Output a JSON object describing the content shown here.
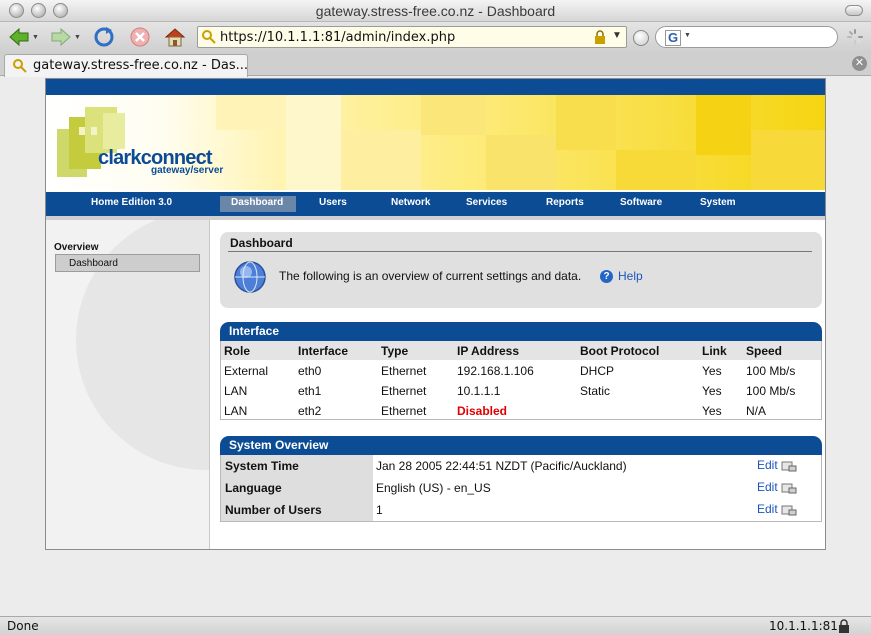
{
  "browser": {
    "window_title": "gateway.stress-free.co.nz - Dashboard",
    "url": "https://10.1.1.1:81/admin/index.php",
    "tab_title": "gateway.stress-free.co.nz - Das...",
    "status_left": "Done",
    "status_right": "10.1.1.1:81",
    "icons": [
      "back-icon",
      "forward-icon",
      "reload-icon",
      "stop-icon",
      "home-icon",
      "lock-icon",
      "google-icon",
      "spinner-icon"
    ]
  },
  "app": {
    "logo_main": "clarkconnect",
    "logo_sub": "gateway/server",
    "edition": "Home Edition 3.0",
    "nav": [
      "Dashboard",
      "Users",
      "Network",
      "Services",
      "Reports",
      "Software",
      "System"
    ],
    "active_nav": "Dashboard",
    "colors": {
      "brand_blue": "#0c4c94",
      "banner_yellow": "#f5d510",
      "error_red": "#e00000",
      "link_blue": "#1c55b8"
    }
  },
  "sidebar": {
    "heading": "Overview",
    "items": [
      "Dashboard"
    ]
  },
  "dashboard": {
    "title": "Dashboard",
    "description": "The following is an overview of current settings and data.",
    "help": "Help"
  },
  "interface": {
    "title": "Interface",
    "columns": [
      "Role",
      "Interface",
      "Type",
      "IP Address",
      "Boot Protocol",
      "Link",
      "Speed"
    ],
    "rows": [
      [
        "External",
        "eth0",
        "Ethernet",
        "192.168.1.106",
        "DHCP",
        "Yes",
        "100 Mb/s"
      ],
      [
        "LAN",
        "eth1",
        "Ethernet",
        "10.1.1.1",
        "Static",
        "Yes",
        "100 Mb/s"
      ],
      [
        "LAN",
        "eth2",
        "Ethernet",
        "Disabled",
        "",
        "Yes",
        "N/A"
      ]
    ]
  },
  "system_overview": {
    "title": "System Overview",
    "edit_label": "Edit",
    "rows": [
      {
        "label": "System Time",
        "value": "Jan 28 2005 22:44:51 NZDT (Pacific/Auckland)"
      },
      {
        "label": "Language",
        "value": "English (US) - en_US"
      },
      {
        "label": "Number of Users",
        "value": "1"
      }
    ]
  }
}
